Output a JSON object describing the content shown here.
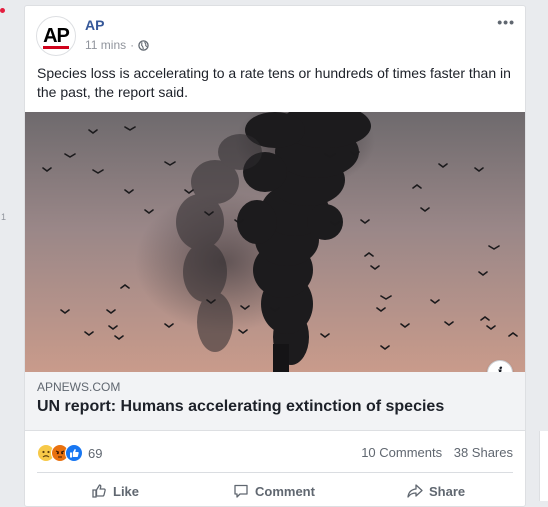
{
  "post": {
    "page_name": "AP",
    "avatar_text": "AP",
    "time": "11 mins",
    "separator": "·",
    "text": "Species loss is accelerating to a rate tens or hundreds of times faster than in the past, the report said."
  },
  "link": {
    "domain": "APNEWS.COM",
    "title": "UN report: Humans accelerating extinction of species"
  },
  "footer": {
    "reaction_icons": [
      "sad-icon",
      "angry-icon",
      "like-icon"
    ],
    "reaction_count": "69",
    "comments": "10 Comments",
    "shares": "38 Shares"
  },
  "actions": {
    "like": "Like",
    "comment": "Comment",
    "share": "Share"
  },
  "left_rail": {
    "number": "1"
  },
  "colors": {
    "link_blue": "#365899",
    "meta_gray": "#90949c",
    "sky_top": "#6f6a6c",
    "sky_bottom": "#c79a8c",
    "smoke": "#1b1a1c"
  }
}
